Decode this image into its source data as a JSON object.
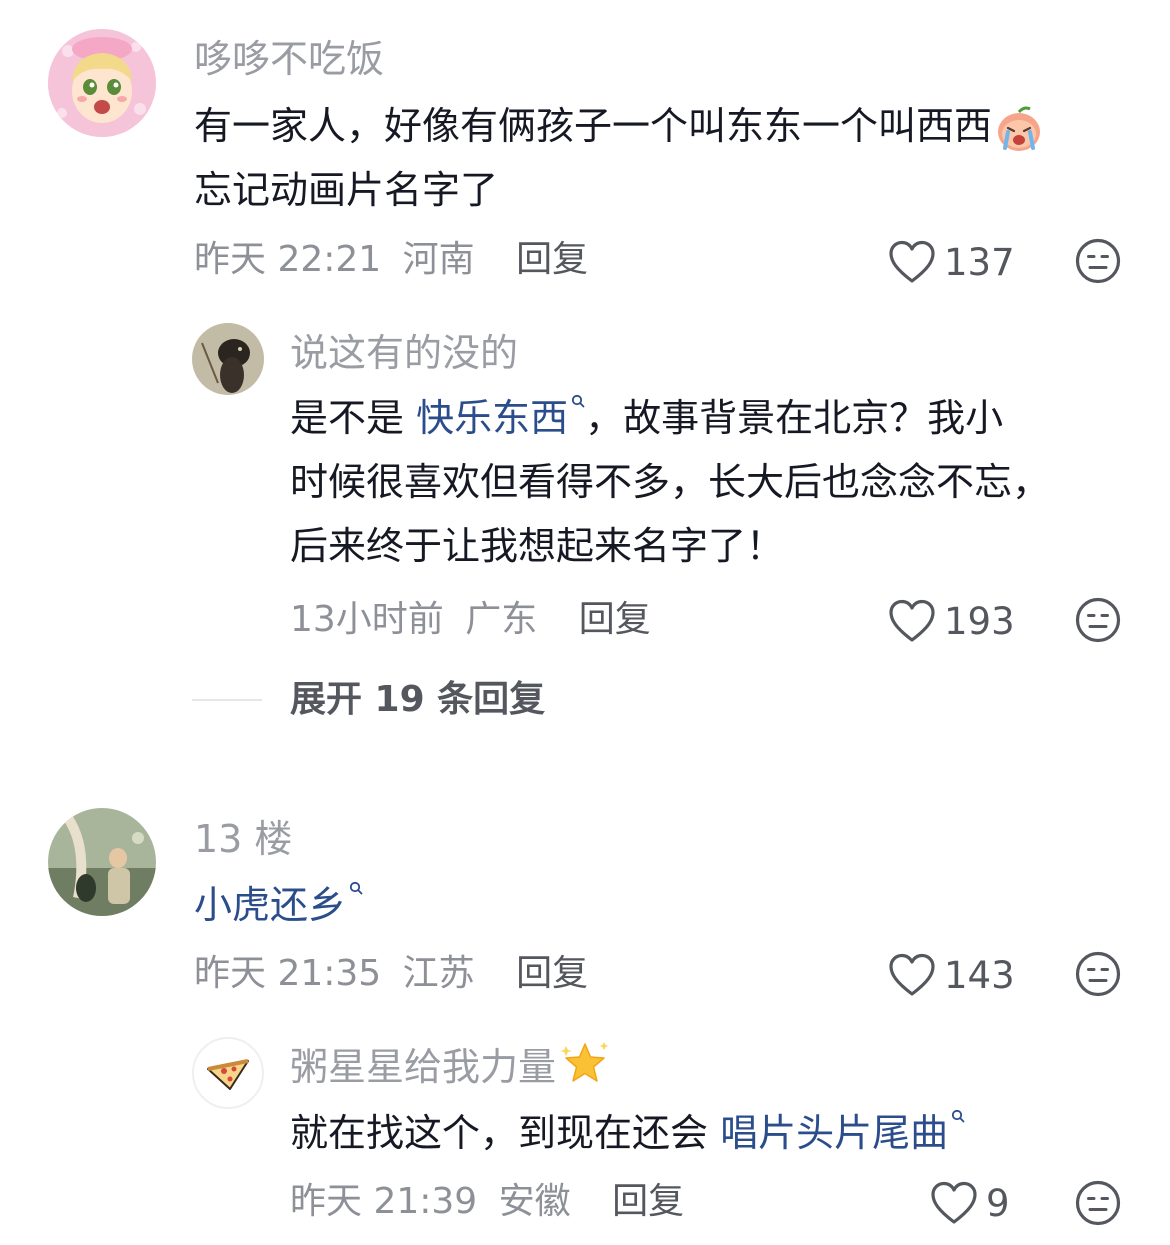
{
  "comments": [
    {
      "username": "哆哆不吃饭",
      "text_line1": "有一家人，好像有俩孩子一个叫东东一个叫西西",
      "text_line2": "忘记动画片名字了",
      "time": "昨天 22:21",
      "location": "河南",
      "reply_label": "回复",
      "likes": "137",
      "emoji": "crying-peach-emoji",
      "replies": [
        {
          "username": "说这有的没的",
          "text_prefix": "是不是 ",
          "link_text": "快乐东西",
          "text_suffix": "，故事背景在北京？我小",
          "text_line2": "时候很喜欢但看得不多，长大后也念念不忘，",
          "text_line3": "后来终于让我想起来名字了！",
          "time": "13小时前",
          "location": "广东",
          "reply_label": "回复",
          "likes": "193"
        }
      ],
      "expand_label": "展开 19 条回复"
    },
    {
      "username": "13 楼",
      "link_text": "小虎还乡",
      "time": "昨天 21:35",
      "location": "江苏",
      "reply_label": "回复",
      "likes": "143",
      "replies": [
        {
          "username": "粥星星给我力量",
          "badge": "sparkle-star-emoji",
          "text_prefix": "就在找这个，到现在还会 ",
          "link_text": "唱片头片尾曲",
          "time": "昨天 21:39",
          "location": "安徽",
          "reply_label": "回复",
          "likes": "9"
        }
      ]
    }
  ],
  "colors": {
    "link": "#2b4d8c",
    "name": "#9a9ca3",
    "meta": "#8e9098",
    "text": "#161823"
  }
}
